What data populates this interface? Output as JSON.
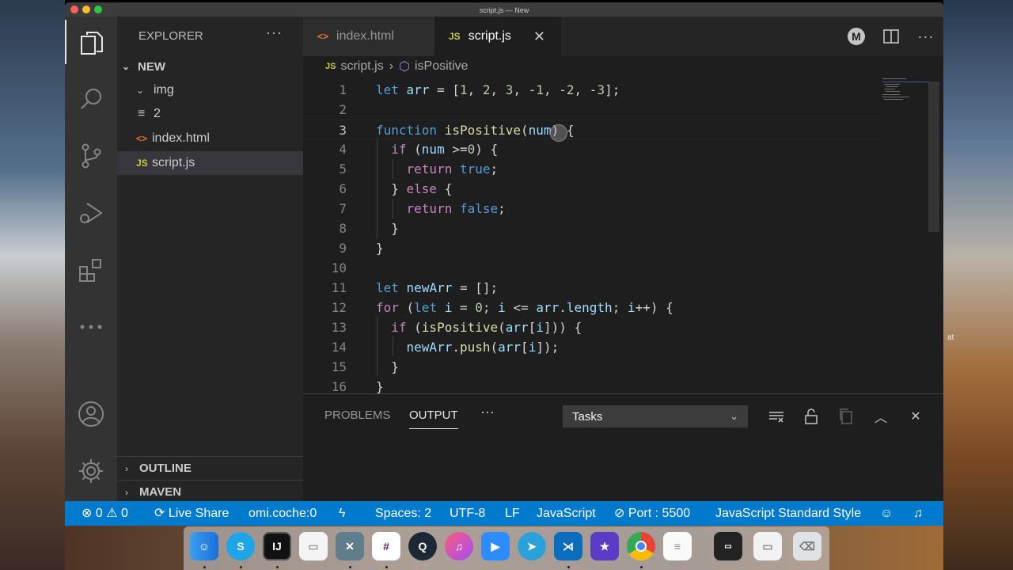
{
  "window": {
    "title": "script.js — New"
  },
  "desktop": {
    "side_text": "at"
  },
  "activity_bar": {
    "items": [
      "files-icon",
      "search-icon",
      "source-control-icon",
      "run-debug-icon",
      "extensions-icon",
      "more-icon"
    ],
    "bottom": [
      "account-icon",
      "settings-gear-icon"
    ]
  },
  "sidebar": {
    "header": "EXPLORER",
    "more": "···",
    "root": "NEW",
    "tree": [
      {
        "label": "img",
        "type": "folder"
      },
      {
        "label": "2",
        "type": "file-text",
        "icon": "≡"
      },
      {
        "label": "index.html",
        "type": "html",
        "icon": "<>"
      },
      {
        "label": "script.js",
        "type": "js",
        "icon": "JS",
        "selected": true
      }
    ],
    "outline": "OUTLINE",
    "maven": "MAVEN"
  },
  "tabs": [
    {
      "label": "index.html",
      "icon": "<>",
      "active": false
    },
    {
      "label": "script.js",
      "icon": "JS",
      "active": true
    }
  ],
  "breadcrumb": {
    "file_icon": "JS",
    "file": "script.js",
    "symbol_icon": "⬡",
    "symbol": "isPositive"
  },
  "editor": {
    "line_numbers": [
      "1",
      "2",
      "3",
      "4",
      "5",
      "6",
      "7",
      "8",
      "9",
      "10",
      "11",
      "12",
      "13",
      "14",
      "15",
      "16"
    ],
    "current_line": 3
  },
  "panel": {
    "tabs": [
      "PROBLEMS",
      "OUTPUT"
    ],
    "active_tab": "OUTPUT",
    "more": "···",
    "select_value": "Tasks"
  },
  "statusbar": {
    "problems": "⊗ 0 ⚠ 0",
    "live_share": "Live Share",
    "user": "omi.coche:0",
    "spaces": "Spaces: 2",
    "encoding": "UTF-8",
    "eol": "LF",
    "language": "JavaScript",
    "port": "Port : 5500",
    "style": "JavaScript Standard Style"
  },
  "colors": {
    "accent": "#007acc",
    "editor_bg": "#1e1e1e",
    "sidebar_bg": "#252526",
    "activity_bg": "#333333"
  },
  "dock": {
    "icons": [
      "finder-icon",
      "skype-icon",
      "intellij-icon",
      "document-icon",
      "xcode-tools-icon",
      "slack-icon",
      "quicktime-icon",
      "itunes-icon",
      "zoom-icon",
      "telegram-icon",
      "vscode-icon",
      "imovie-icon",
      "chrome-icon",
      "notes-icon",
      "screen-icon",
      "window-icon",
      "trash-icon"
    ]
  }
}
